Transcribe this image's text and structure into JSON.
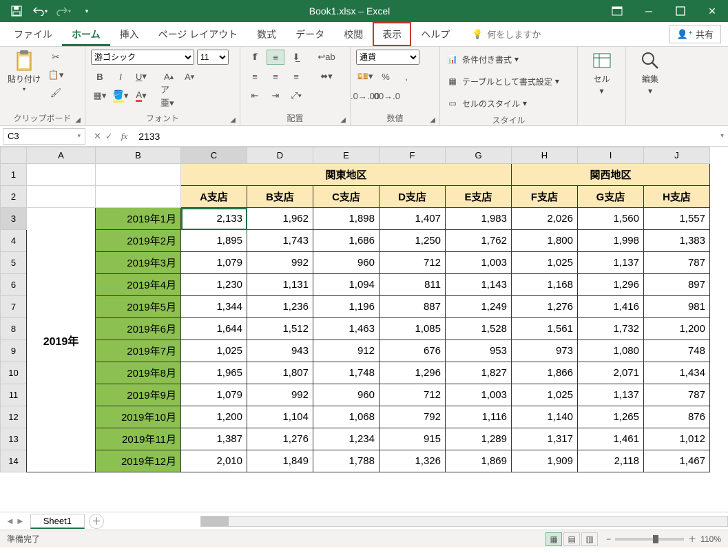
{
  "title": "Book1.xlsx  –  Excel",
  "tabs": {
    "file": "ファイル",
    "home": "ホーム",
    "insert": "挿入",
    "layout": "ページ レイアウト",
    "formulas": "数式",
    "data": "データ",
    "review": "校閲",
    "view": "表示",
    "help": "ヘルプ",
    "tell": "何をしますか",
    "share": "共有"
  },
  "ribbon": {
    "clipboard": {
      "paste": "貼り付け",
      "label": "クリップボード"
    },
    "font": {
      "name": "游ゴシック",
      "size": "11",
      "label": "フォント"
    },
    "align": {
      "label": "配置"
    },
    "number": {
      "format": "通貨",
      "label": "数値"
    },
    "styles": {
      "cond": "条件付き書式",
      "table": "テーブルとして書式設定",
      "cell": "セルのスタイル",
      "label": "スタイル"
    },
    "cells": {
      "label": "セル"
    },
    "editing": {
      "label": "編集"
    }
  },
  "namebox": "C3",
  "formula": "2133",
  "cols": [
    "A",
    "B",
    "C",
    "D",
    "E",
    "F",
    "G",
    "H",
    "I",
    "J"
  ],
  "regions": {
    "kanto": "関東地区",
    "kansai": "関西地区"
  },
  "shops": [
    "A支店",
    "B支店",
    "C支店",
    "D支店",
    "E支店",
    "F支店",
    "G支店",
    "H支店"
  ],
  "year": "2019年",
  "rows": [
    {
      "m": "2019年1月",
      "v": [
        "2,133",
        "1,962",
        "1,898",
        "1,407",
        "1,983",
        "2,026",
        "1,560",
        "1,557"
      ]
    },
    {
      "m": "2019年2月",
      "v": [
        "1,895",
        "1,743",
        "1,686",
        "1,250",
        "1,762",
        "1,800",
        "1,998",
        "1,383"
      ]
    },
    {
      "m": "2019年3月",
      "v": [
        "1,079",
        "992",
        "960",
        "712",
        "1,003",
        "1,025",
        "1,137",
        "787"
      ]
    },
    {
      "m": "2019年4月",
      "v": [
        "1,230",
        "1,131",
        "1,094",
        "811",
        "1,143",
        "1,168",
        "1,296",
        "897"
      ]
    },
    {
      "m": "2019年5月",
      "v": [
        "1,344",
        "1,236",
        "1,196",
        "887",
        "1,249",
        "1,276",
        "1,416",
        "981"
      ]
    },
    {
      "m": "2019年6月",
      "v": [
        "1,644",
        "1,512",
        "1,463",
        "1,085",
        "1,528",
        "1,561",
        "1,732",
        "1,200"
      ]
    },
    {
      "m": "2019年7月",
      "v": [
        "1,025",
        "943",
        "912",
        "676",
        "953",
        "973",
        "1,080",
        "748"
      ]
    },
    {
      "m": "2019年8月",
      "v": [
        "1,965",
        "1,807",
        "1,748",
        "1,296",
        "1,827",
        "1,866",
        "2,071",
        "1,434"
      ]
    },
    {
      "m": "2019年9月",
      "v": [
        "1,079",
        "992",
        "960",
        "712",
        "1,003",
        "1,025",
        "1,137",
        "787"
      ]
    },
    {
      "m": "2019年10月",
      "v": [
        "1,200",
        "1,104",
        "1,068",
        "792",
        "1,116",
        "1,140",
        "1,265",
        "876"
      ]
    },
    {
      "m": "2019年11月",
      "v": [
        "1,387",
        "1,276",
        "1,234",
        "915",
        "1,289",
        "1,317",
        "1,461",
        "1,012"
      ]
    },
    {
      "m": "2019年12月",
      "v": [
        "2,010",
        "1,849",
        "1,788",
        "1,326",
        "1,869",
        "1,909",
        "2,118",
        "1,467"
      ]
    }
  ],
  "sheet_tab": "Sheet1",
  "status": "準備完了",
  "zoom": "110%"
}
